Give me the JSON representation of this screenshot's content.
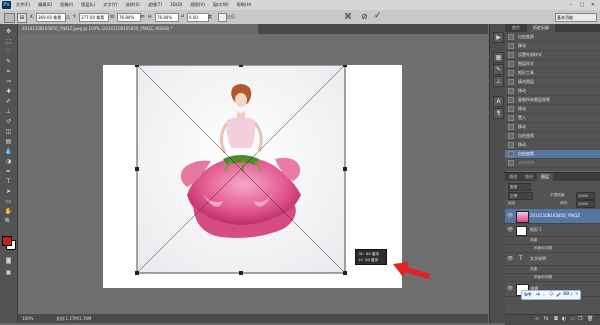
{
  "app": {
    "logo": "Ps",
    "menus": [
      "文件(F)",
      "编辑(E)",
      "图像(I)",
      "图层(L)",
      "文字(Y)",
      "选择(S)",
      "滤镜(T)",
      "3D(D)",
      "视图(V)",
      "窗口(W)",
      "帮助(H)"
    ],
    "window_controls": [
      "–",
      "□",
      "✕"
    ]
  },
  "options": {
    "x_label": "X:",
    "x_value": "369.00 像素",
    "y_label": "Y:",
    "y_value": "277.00 像素",
    "w_label": "W:",
    "w_value": "76.84%",
    "h_label": "H:",
    "h_value": "76.84%",
    "angle_value": "0.00",
    "angle_unit": "度",
    "interp_label": "插值",
    "workspace": "基本功能"
  },
  "document": {
    "tab_title": "20141108165850_YNiQZ.jpeg @ 100% (20141108165850_YNiQZ, RGB/8) *",
    "status_zoom": "100%",
    "status_info": "文档:1.37M/1.78M",
    "transform_hud": [
      "W：84 厘米",
      "H：84 厘米"
    ]
  },
  "history": {
    "tabs": [
      "颜色",
      "历史记录"
    ],
    "items": [
      {
        "label": "自由变换",
        "state": "normal"
      },
      {
        "label": "移动",
        "state": "normal"
      },
      {
        "label": "设置外部样式",
        "state": "normal"
      },
      {
        "label": "图层样式",
        "state": "normal"
      },
      {
        "label": "矩形工具",
        "state": "normal"
      },
      {
        "label": "填充图层",
        "state": "normal"
      },
      {
        "label": "移动",
        "state": "normal"
      },
      {
        "label": "复制所有图层效果",
        "state": "normal"
      },
      {
        "label": "移动",
        "state": "normal"
      },
      {
        "label": "置入",
        "state": "normal"
      },
      {
        "label": "移动",
        "state": "normal"
      },
      {
        "label": "自由变换",
        "state": "normal"
      },
      {
        "label": "移动",
        "state": "normal"
      },
      {
        "label": "自由变换",
        "state": "selected"
      },
      {
        "label": "自由变换",
        "state": "dim"
      }
    ]
  },
  "layers": {
    "tabs": [
      "通道",
      "路径",
      "图层"
    ],
    "kind_label": "类型",
    "blend_mode": "正常",
    "opacity_label": "不透明度:",
    "opacity_value": "100%",
    "lock_label": "锁定:",
    "fill_label": "填充:",
    "fill_value": "100%",
    "items": [
      {
        "name": "20141108165850_YNiQZ",
        "selected": true
      },
      {
        "name": "矩形 1"
      },
      {
        "name": "效果"
      },
      {
        "name": "斜面和浮雕"
      },
      {
        "name": "文字说明"
      },
      {
        "name": "效果"
      },
      {
        "name": "斜面和浮雕"
      },
      {
        "name": "背景"
      }
    ],
    "bottom_icons": [
      "link-icon",
      "fx-icon",
      "mask-icon",
      "adjustment-icon",
      "group-icon",
      "new-layer-icon",
      "trash-icon"
    ]
  },
  "ime": {
    "label": "S中",
    "items": [
      "中",
      "。",
      "☺",
      "🎤",
      "⌨",
      "👕",
      "✎"
    ]
  },
  "colors": {
    "accent": "#5675a3",
    "arrow": "#e32222",
    "foreground": "#c31f1f",
    "background": "#ffffff"
  }
}
